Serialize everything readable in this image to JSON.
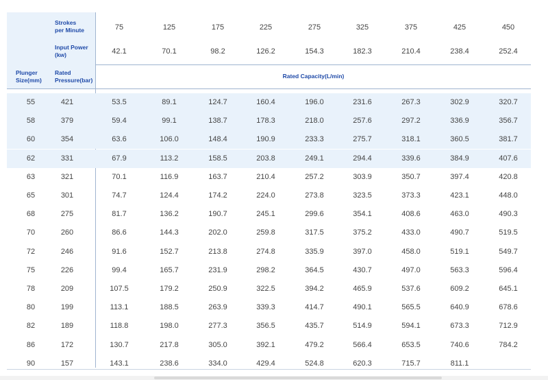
{
  "header": {
    "speed_label": "Strokes\nper Minute",
    "power_label": "Input Power\n(kw)",
    "plunger_label": "Plunger\nSize(mm)",
    "pressure_label": "Rated\nPressure(bar)",
    "capacity_label": "Rated Capacity(L/min)",
    "speeds": [
      "75",
      "125",
      "175",
      "225",
      "275",
      "325",
      "375",
      "425",
      "450"
    ],
    "powers": [
      "42.1",
      "70.1",
      "98.2",
      "126.2",
      "154.3",
      "182.3",
      "210.4",
      "238.4",
      "252.4"
    ]
  },
  "rows": [
    {
      "size": "55",
      "pressure": "421",
      "values": [
        "53.5",
        "89.1",
        "124.7",
        "160.4",
        "196.0",
        "231.6",
        "267.3",
        "302.9",
        "320.7"
      ]
    },
    {
      "size": "58",
      "pressure": "379",
      "values": [
        "59.4",
        "99.1",
        "138.7",
        "178.3",
        "218.0",
        "257.6",
        "297.2",
        "336.9",
        "356.7"
      ]
    },
    {
      "size": "60",
      "pressure": "354",
      "values": [
        "63.6",
        "106.0",
        "148.4",
        "190.9",
        "233.3",
        "275.7",
        "318.1",
        "360.5",
        "381.7"
      ]
    },
    {
      "size": "62",
      "pressure": "331",
      "values": [
        "67.9",
        "113.2",
        "158.5",
        "203.8",
        "249.1",
        "294.4",
        "339.6",
        "384.9",
        "407.6"
      ]
    },
    {
      "size": "63",
      "pressure": "321",
      "values": [
        "70.1",
        "116.9",
        "163.7",
        "210.4",
        "257.2",
        "303.9",
        "350.7",
        "397.4",
        "420.8"
      ]
    },
    {
      "size": "65",
      "pressure": "301",
      "values": [
        "74.7",
        "124.4",
        "174.2",
        "224.0",
        "273.8",
        "323.5",
        "373.3",
        "423.1",
        "448.0"
      ]
    },
    {
      "size": "68",
      "pressure": "275",
      "values": [
        "81.7",
        "136.2",
        "190.7",
        "245.1",
        "299.6",
        "354.1",
        "408.6",
        "463.0",
        "490.3"
      ]
    },
    {
      "size": "70",
      "pressure": "260",
      "values": [
        "86.6",
        "144.3",
        "202.0",
        "259.8",
        "317.5",
        "375.2",
        "433.0",
        "490.7",
        "519.5"
      ]
    },
    {
      "size": "72",
      "pressure": "246",
      "values": [
        "91.6",
        "152.7",
        "213.8",
        "274.8",
        "335.9",
        "397.0",
        "458.0",
        "519.1",
        "549.7"
      ]
    },
    {
      "size": "75",
      "pressure": "226",
      "values": [
        "99.4",
        "165.7",
        "231.9",
        "298.2",
        "364.5",
        "430.7",
        "497.0",
        "563.3",
        "596.4"
      ]
    },
    {
      "size": "78",
      "pressure": "209",
      "values": [
        "107.5",
        "179.2",
        "250.9",
        "322.5",
        "394.2",
        "465.9",
        "537.6",
        "609.2",
        "645.1"
      ]
    },
    {
      "size": "80",
      "pressure": "199",
      "values": [
        "113.1",
        "188.5",
        "263.9",
        "339.3",
        "414.7",
        "490.1",
        "565.5",
        "640.9",
        "678.6"
      ]
    },
    {
      "size": "82",
      "pressure": "189",
      "values": [
        "118.8",
        "198.0",
        "277.3",
        "356.5",
        "435.7",
        "514.9",
        "594.1",
        "673.3",
        "712.9"
      ]
    },
    {
      "size": "86",
      "pressure": "172",
      "values": [
        "130.7",
        "217.8",
        "305.0",
        "392.1",
        "479.2",
        "566.4",
        "653.5",
        "740.6",
        "784.2"
      ]
    },
    {
      "size": "90",
      "pressure": "157",
      "values": [
        "143.1",
        "238.6",
        "334.0",
        "429.4",
        "524.8",
        "620.3",
        "715.7",
        "811.1",
        ""
      ]
    }
  ]
}
